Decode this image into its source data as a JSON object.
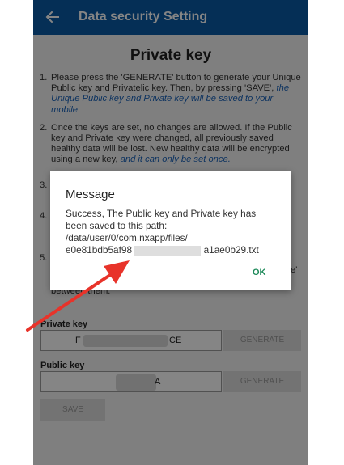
{
  "appbar": {
    "title": "Data security Setting",
    "back_icon": "arrow-left-icon"
  },
  "page": {
    "heading": "Private key"
  },
  "instructions": [
    {
      "num": "1.",
      "text": "Please press the 'GENERATE' button to generate your Unique Public key and Privatelic key. Then, by pressing 'SAVE', ",
      "link": "the Unique Public key and Private key will be saved to your mobile"
    },
    {
      "num": "2.",
      "text": "Once the keys are set, no changes are allowed. If the Public key and Private key were changed, all previously saved healthy data will be lost. New healthy data will be encrypted using a new key, ",
      "link": "and it can only be set once."
    },
    {
      "num": "3.",
      "text": "",
      "link": ""
    },
    {
      "num": "4.",
      "text": "",
      "link": ""
    },
    {
      "num": "5.",
      "text": "",
      "link": ""
    }
  ],
  "partial_visible": {
    "right_quote": "e'",
    "between_them": "between them."
  },
  "private_key": {
    "label": "Private key",
    "value_left": "F",
    "value_right": "CE",
    "generate_label": "GENERATE"
  },
  "public_key": {
    "label": "Public key",
    "value_right": "A",
    "generate_label": "GENERATE"
  },
  "save_label": "SAVE",
  "dialog": {
    "title": "Message",
    "line1": "Success, The Public key and Private key has",
    "line2": "been saved to this path:",
    "line3": "/data/user/0/com.nxapp/files/",
    "line4_start": "e0e81bdb5af98",
    "line4_end": "a1ae0b29.txt",
    "ok_label": "OK"
  },
  "colors": {
    "appbar": "#0b5aa6",
    "link": "#1a62b8",
    "ok": "#1e8a5a",
    "arrow": "#e8332a"
  }
}
